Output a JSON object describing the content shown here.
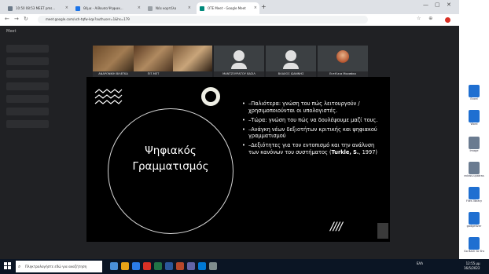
{
  "browser": {
    "tabs": [
      {
        "label": "10:50 08:53 MEET pms..."
      },
      {
        "label": "Θέμα - Αίθουσα Ψηφιακ..."
      },
      {
        "label": "Νέα καρτέλα"
      },
      {
        "label": "OTE Meet - Google Meet"
      }
    ],
    "new_tab": "+",
    "url": "meet.google.com/vch-tqfw-kqx?authuser=1&hs=179",
    "window_controls": [
      "—",
      "▢",
      "✕"
    ]
  },
  "meet": {
    "logo": "Meet",
    "participants": [
      {
        "name": "ΑΝΔΡΟΝΙΚΗ ΒΙΛΕΓΚΑ",
        "type": "video"
      },
      {
        "name": "ΠΙΤ.ΜΕΤ",
        "type": "video"
      },
      {
        "name": "",
        "type": "video"
      },
      {
        "name": "ΜΑΝΤΖΟΥΡΑΤΟΥ ΒΑΣΙΛ",
        "type": "avatar"
      },
      {
        "name": "ΒΛΑΧΟΣ ΙΩΑΝΝΗΣ",
        "type": "avatar"
      },
      {
        "name": "Ευτέλεια Μουσάκα",
        "type": "photo"
      }
    ]
  },
  "slide": {
    "title_line1": "Ψηφιακός",
    "title_line2": "Γραμματισμός",
    "bullets": [
      "–Παλιότερα: γνώση του πώς λειτουργούν / χρησιμοποιούνται οι υπολογιστές.",
      "–Τώρα: γνώση του πώς να δουλέψουμε μαζί τους.",
      "–Ανάγκη νέων δεξιοτήτων κριτικής και ψηφιακού γραμματισμού",
      "–Δεξιότητες για τον εντοπισμό και την ανάλυση των κανόνων του συστήματος ("
    ],
    "citation": "Turkle, S.",
    "citation_tail": ", 1997)",
    "hatch": "////"
  },
  "desktop_icons": [
    {
      "label": "Excel"
    },
    {
      "label": "Word"
    },
    {
      "label": "Image"
    },
    {
      "label": "eclass.upatras"
    },
    {
      "label": "Files library"
    },
    {
      "label": "gadgetizer"
    },
    {
      "label": "Go Back to Shortcuts"
    }
  ],
  "taskbar": {
    "search_placeholder": "Πληκτρολογήστε εδώ για αναζήτηση",
    "tray_text": "ΕΛΛ",
    "time": "12:55 μμ",
    "date": "16/5/2022"
  },
  "colors": {
    "meet_bg": "#202124",
    "slide_bg": "#000000",
    "taskbar_bg": "#0b1524",
    "record": "#d93025",
    "desktop_icon": "#1f6fd1"
  }
}
